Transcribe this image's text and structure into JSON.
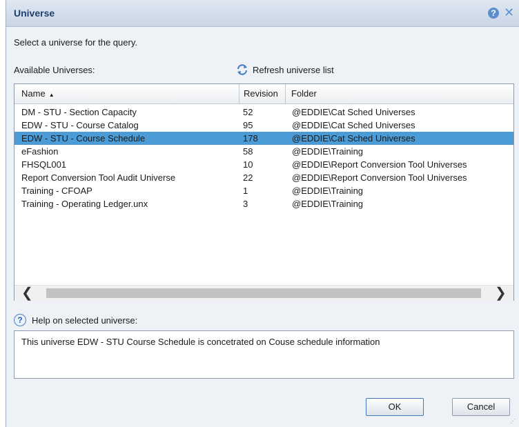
{
  "dialog": {
    "title": "Universe",
    "prompt": "Select a universe for the query.",
    "available_label": "Available Universes:",
    "refresh_label": "Refresh universe list"
  },
  "table": {
    "columns": [
      "Name",
      "Revision",
      "Folder"
    ],
    "sorted_column": "Name",
    "rows": [
      {
        "name": "DM - STU - Section Capacity",
        "revision": "52",
        "folder": "@EDDIE\\Cat Sched Universes",
        "selected": false
      },
      {
        "name": "EDW - STU - Course Catalog",
        "revision": "95",
        "folder": "@EDDIE\\Cat Sched Universes",
        "selected": false
      },
      {
        "name": "EDW - STU - Course Schedule",
        "revision": "178",
        "folder": "@EDDIE\\Cat Sched Universes",
        "selected": true
      },
      {
        "name": "eFashion",
        "revision": "58",
        "folder": "@EDDIE\\Training",
        "selected": false
      },
      {
        "name": "FHSQL001",
        "revision": "10",
        "folder": "@EDDIE\\Report Conversion Tool Universes",
        "selected": false
      },
      {
        "name": "Report Conversion Tool Audit Universe",
        "revision": "22",
        "folder": "@EDDIE\\Report Conversion Tool Universes",
        "selected": false
      },
      {
        "name": "Training - CFOAP",
        "revision": "1",
        "folder": "@EDDIE\\Training",
        "selected": false
      },
      {
        "name": "Training - Operating Ledger.unx",
        "revision": "3",
        "folder": "@EDDIE\\Training",
        "selected": false
      }
    ]
  },
  "help": {
    "label": "Help on selected universe:",
    "text": "This universe EDW - STU Course Schedule is concetrated on Couse schedule information"
  },
  "buttons": {
    "ok": "OK",
    "cancel": "Cancel"
  },
  "icons": {
    "help": "help-icon",
    "close": "close-icon",
    "refresh": "refresh-icon",
    "sort": "sort-ascending-icon",
    "scroll_left": "chevron-left-icon",
    "scroll_right": "chevron-right-icon"
  },
  "colors": {
    "selection": "#4b9bd6",
    "title_text": "#1d3f6e",
    "titlebar": "#c9d6e6"
  }
}
